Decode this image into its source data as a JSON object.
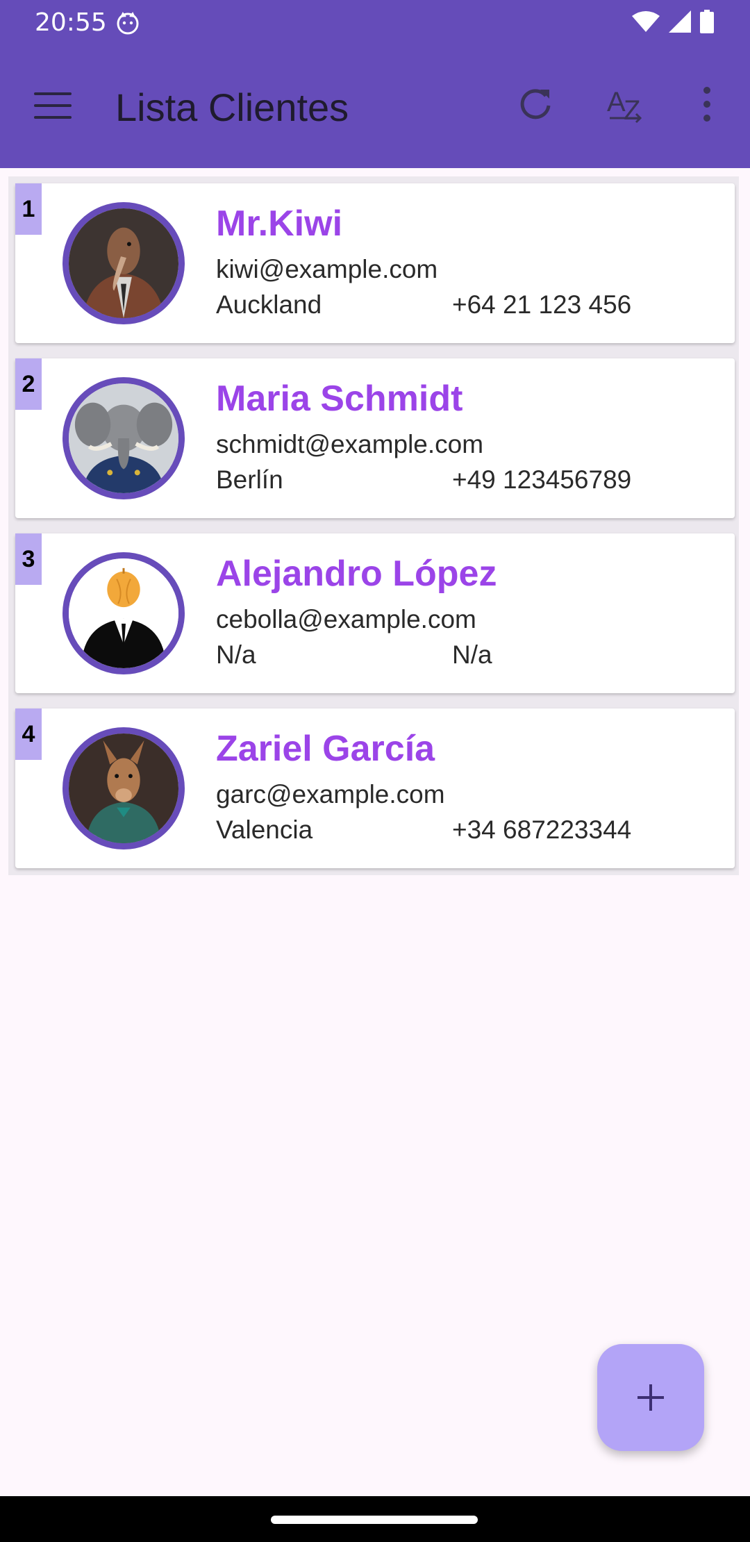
{
  "status_bar": {
    "time": "20:55"
  },
  "app_bar": {
    "title": "Lista Clientes"
  },
  "clients": [
    {
      "index": "1",
      "name": "Mr.Kiwi",
      "email": "kiwi@example.com",
      "city": "Auckland",
      "phone": "+64 21 123 456"
    },
    {
      "index": "2",
      "name": "Maria Schmidt",
      "email": "schmidt@example.com",
      "city": "Berlín",
      "phone": "+49 123456789"
    },
    {
      "index": "3",
      "name": "Alejandro López",
      "email": "cebolla@example.com",
      "city": "N/a",
      "phone": "N/a"
    },
    {
      "index": "4",
      "name": "Zariel García",
      "email": "garc@example.com",
      "city": "Valencia",
      "phone": "+34 687223344"
    }
  ],
  "icons": {
    "menu": "hamburger-menu-icon",
    "refresh": "refresh-icon",
    "sort": "sort-az-icon",
    "more": "more-vert-icon",
    "add": "plus-icon"
  },
  "colors": {
    "app_bar": "#654cb9",
    "name_text": "#9b44e8",
    "avatar_ring": "#674cba",
    "index_badge": "#b9aaf1",
    "fab": "#b3a4f7"
  }
}
